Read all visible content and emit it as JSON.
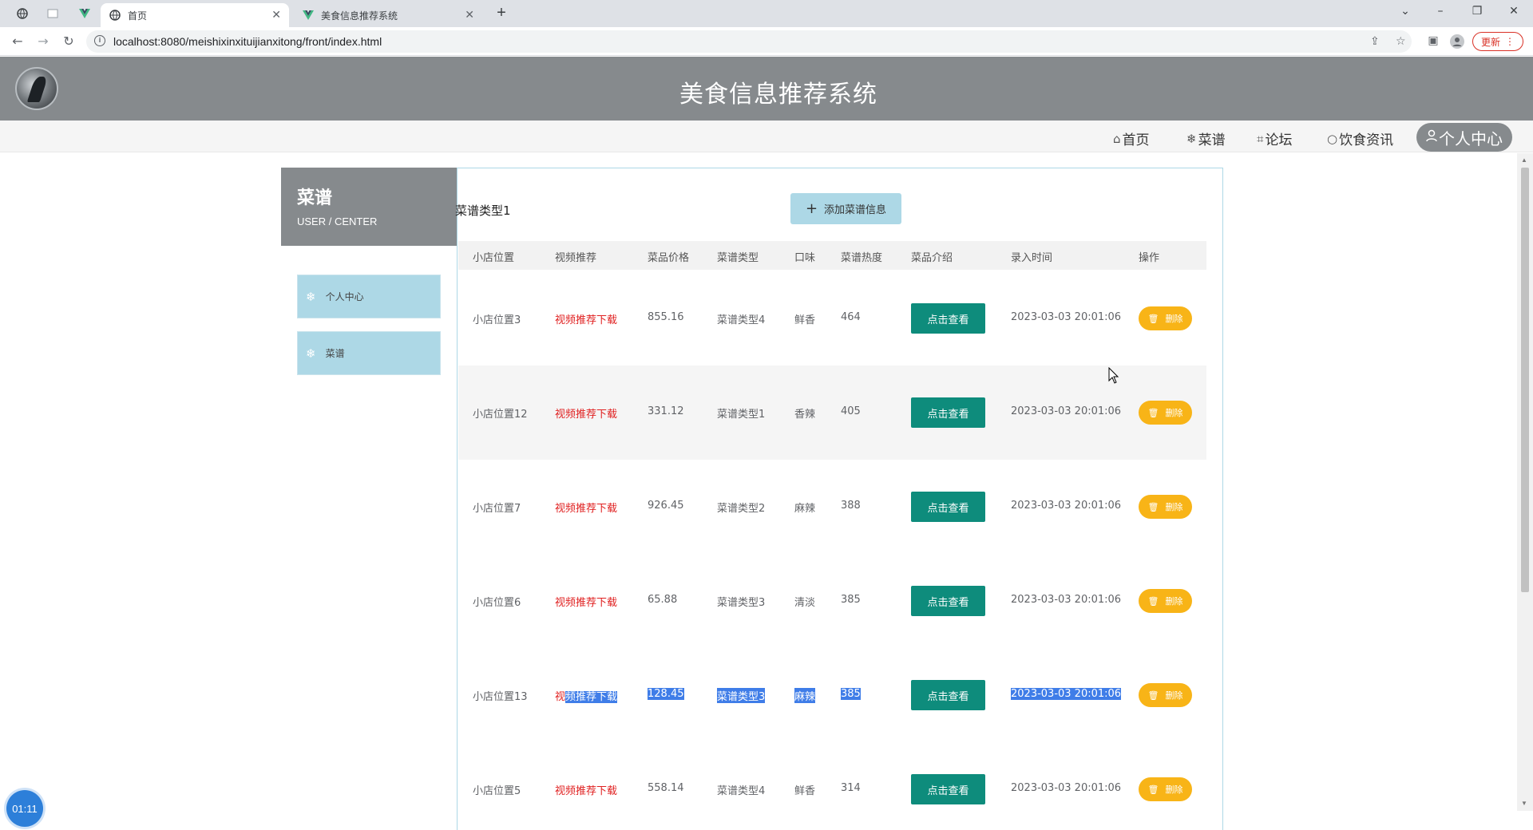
{
  "browser": {
    "tabs": [
      {
        "label": "首页",
        "active": true
      },
      {
        "label": "美食信息推荐系统",
        "active": false
      }
    ],
    "url": "localhost:8080/meishixinxituijianxitong/front/index.html",
    "update_label": "更新"
  },
  "site": {
    "title": "美食信息推荐系统",
    "nav": [
      {
        "icon": "home-icon",
        "label": "首页"
      },
      {
        "icon": "snowflake-icon",
        "label": "菜谱"
      },
      {
        "icon": "tag-icon",
        "label": "论坛"
      },
      {
        "icon": "circle-icon",
        "label": "饮食资讯"
      },
      {
        "icon": "user-icon",
        "label": "个人中心",
        "active": true
      }
    ]
  },
  "sidebar": {
    "title": "菜谱",
    "subtitle": "USER / CENTER",
    "items": [
      {
        "label": "个人中心"
      },
      {
        "label": "菜谱"
      }
    ]
  },
  "main": {
    "type_label": "菜谱类型1",
    "add_button": "添加菜谱信息",
    "columns": [
      "小店位置",
      "视频推荐",
      "菜品价格",
      "菜谱类型",
      "口味",
      "菜谱热度",
      "菜品介绍",
      "录入时间",
      "操作"
    ],
    "view_label": "点击查看",
    "delete_label": "删除",
    "rows": [
      {
        "location": "小店位置3",
        "video": "视频推荐下载",
        "price": "855.16",
        "type": "菜谱类型4",
        "taste": "鲜香",
        "heat": "464",
        "time": "2023-03-03 20:01:06"
      },
      {
        "location": "小店位置12",
        "video": "视频推荐下载",
        "price": "331.12",
        "type": "菜谱类型1",
        "taste": "香辣",
        "heat": "405",
        "time": "2023-03-03 20:01:06"
      },
      {
        "location": "小店位置7",
        "video": "视频推荐下载",
        "price": "926.45",
        "type": "菜谱类型2",
        "taste": "麻辣",
        "heat": "388",
        "time": "2023-03-03 20:01:06"
      },
      {
        "location": "小店位置6",
        "video": "视频推荐下载",
        "price": "65.88",
        "type": "菜谱类型3",
        "taste": "清淡",
        "heat": "385",
        "time": "2023-03-03 20:01:06"
      },
      {
        "location": "小店位置13",
        "video_a": "视",
        "video_b": "频推荐下载",
        "price": "128.45",
        "type": "菜谱类型3",
        "taste": "麻辣",
        "heat": "385",
        "time": "2023-03-03 20:01:06"
      },
      {
        "location": "小店位置5",
        "video": "视频推荐下载",
        "price": "558.14",
        "type": "菜谱类型4",
        "taste": "鲜香",
        "heat": "314",
        "time": "2023-03-03 20:01:06"
      }
    ]
  },
  "timer": "01:11"
}
